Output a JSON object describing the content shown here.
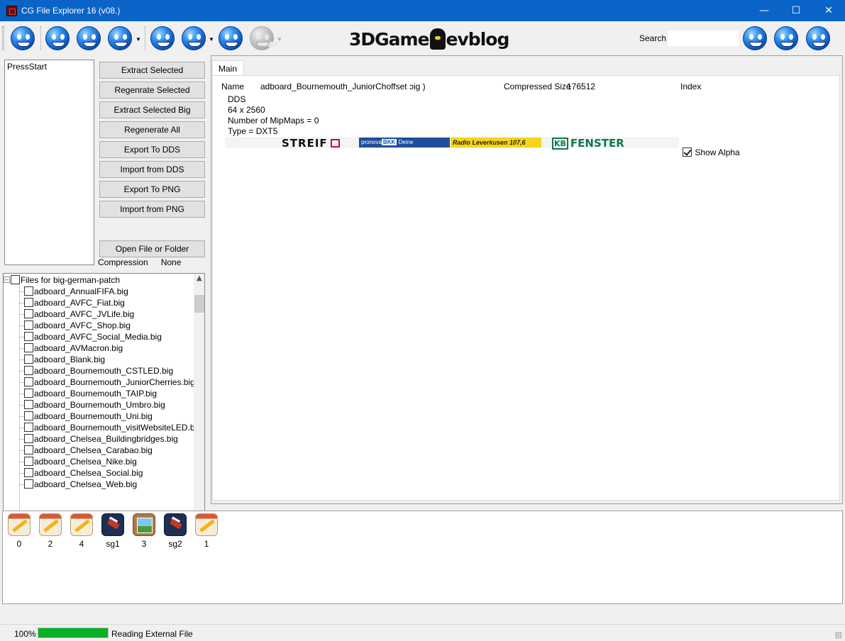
{
  "window": {
    "title": "CG File Explorer 16 (v08.)",
    "controls": {
      "minimize": "—",
      "maximize": "☐",
      "close": "✕"
    }
  },
  "toolbar": {
    "logo": {
      "before": "3DGame",
      "after": "evblog"
    },
    "search_label": "Search",
    "search_value": "",
    "icons": [
      "smiley-icon",
      "smiley-icon",
      "smiley-icon",
      "smiley-icon",
      "smiley-icon",
      "smiley-icon",
      "smiley-icon",
      "smiley-icon-disabled",
      "smiley-icon",
      "smiley-icon",
      "smiley-icon"
    ]
  },
  "left": {
    "list_items": [
      "PressStart"
    ],
    "buttons": {
      "extract_selected": "Extract Selected",
      "regenerate_selected": "Regenrate Selected",
      "extract_selected_big": "Extract Selected Big",
      "regenerate_all": "Regenerate All",
      "export_dds": "Export To DDS",
      "import_dds": "Import from DDS",
      "export_png": "Export To PNG",
      "import_png": "Import from PNG",
      "open_file": "Open File or Folder"
    },
    "compression_label": "Compression",
    "compression_value": "None"
  },
  "tree": {
    "root": "Files for big-german-patch",
    "files": [
      "adboard_AnnualFIFA.big",
      "adboard_AVFC_Fiat.big",
      "adboard_AVFC_JVLife.big",
      "adboard_AVFC_Shop.big",
      "adboard_AVFC_Social_Media.big",
      "adboard_AVMacron.big",
      "adboard_Blank.big",
      "adboard_Bournemouth_CSTLED.big",
      "adboard_Bournemouth_JuniorCherries.big",
      "adboard_Bournemouth_TAIP.big",
      "adboard_Bournemouth_Umbro.big",
      "adboard_Bournemouth_Uni.big",
      "adboard_Bournemouth_visitWebsiteLED.big",
      "adboard_Chelsea_Buildingbridges.big",
      "adboard_Chelsea_Carabao.big",
      "adboard_Chelsea_Nike.big",
      "adboard_Chelsea_Social.big",
      "adboard_Chelsea_Web.big"
    ]
  },
  "main": {
    "tab_label": "Main",
    "name_label": "Name",
    "name_value": "adboard_Bournemouth_JuniorCh",
    "name_overlay": "offset",
    "name_suffix": "ɔig )",
    "compressed_label": "Compressed Size",
    "compressed_value": "176512",
    "index_label": "Index",
    "format": "DDS",
    "dimensions": "64 x 2560",
    "mipmaps": "Number of MipMaps = 0",
    "type": "Type = DXT5",
    "banner": {
      "streif": "STREIF",
      "pronova_brand": "pronova",
      "pronova_bkk": "BKK",
      "pronova_tagline": "Deine Krankenkasse",
      "radio": "Radio Leverkusen 107,6",
      "fenster_mark": "KB",
      "fenster": "FENSTER"
    },
    "show_alpha_label": "Show Alpha",
    "show_alpha_checked": true
  },
  "bottom": {
    "items": [
      {
        "label": "0",
        "icon": "pencil-notepad-icon"
      },
      {
        "label": "2",
        "icon": "pencil-notepad-icon"
      },
      {
        "label": "4",
        "icon": "pencil-notepad-icon"
      },
      {
        "label": "sg1",
        "icon": "game-icon"
      },
      {
        "label": "3",
        "icon": "photo-icon"
      },
      {
        "label": "sg2",
        "icon": "game-icon"
      },
      {
        "label": "1",
        "icon": "pencil-notepad-icon"
      }
    ]
  },
  "status": {
    "percent_text": "100%",
    "progress": 1.0,
    "text": "Reading External File"
  }
}
